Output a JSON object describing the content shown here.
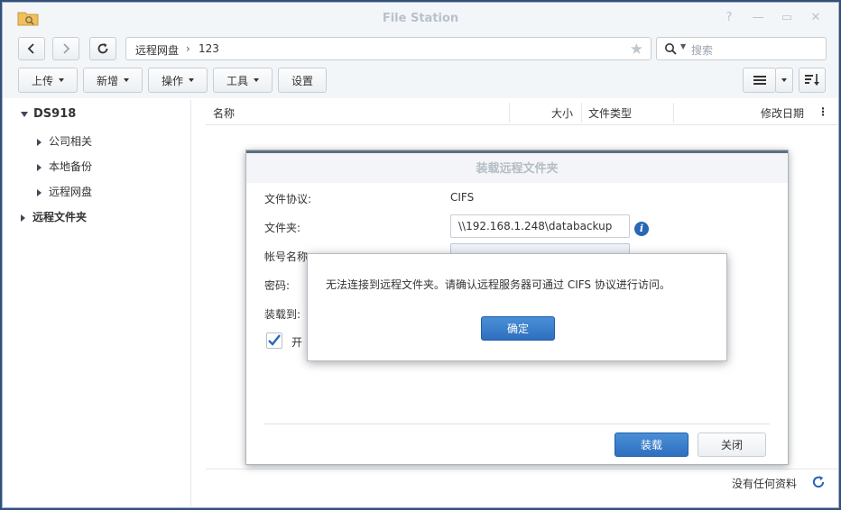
{
  "window": {
    "title": "File Station"
  },
  "breadcrumb": {
    "items": [
      "远程网盘",
      "123"
    ]
  },
  "search": {
    "placeholder": "搜索"
  },
  "toolbar": {
    "upload_label": "上传",
    "new_label": "新增",
    "action_label": "操作",
    "tools_label": "工具",
    "settings_label": "设置"
  },
  "sidebar": {
    "root": "DS918",
    "items": [
      {
        "label": "公司相关"
      },
      {
        "label": "本地备份"
      },
      {
        "label": "远程网盘"
      }
    ],
    "remote_folder": "远程文件夹"
  },
  "file_list": {
    "columns": [
      "名称",
      "大小",
      "文件类型",
      "修改日期"
    ]
  },
  "status": {
    "text": "没有任何资料"
  },
  "mount_dialog": {
    "title": "装载远程文件夹",
    "protocol_label": "文件协议:",
    "protocol_value": "CIFS",
    "folder_label": "文件夹:",
    "folder_value": "\\\\192.168.1.248\\databackup",
    "account_label": "帐号名称:",
    "password_label": "密码:",
    "mount_to_label": "装载到:",
    "checkbox_label": "开",
    "mount_button": "装载",
    "close_button": "关闭"
  },
  "alert": {
    "message": "无法连接到远程文件夹。请确认远程服务器可通过 CIFS 协议进行访问。",
    "ok_button": "确定"
  },
  "colors": {
    "desktop": "#34507a",
    "primary_button": "#2f6fbf",
    "folder_icon": "#f0c060"
  }
}
